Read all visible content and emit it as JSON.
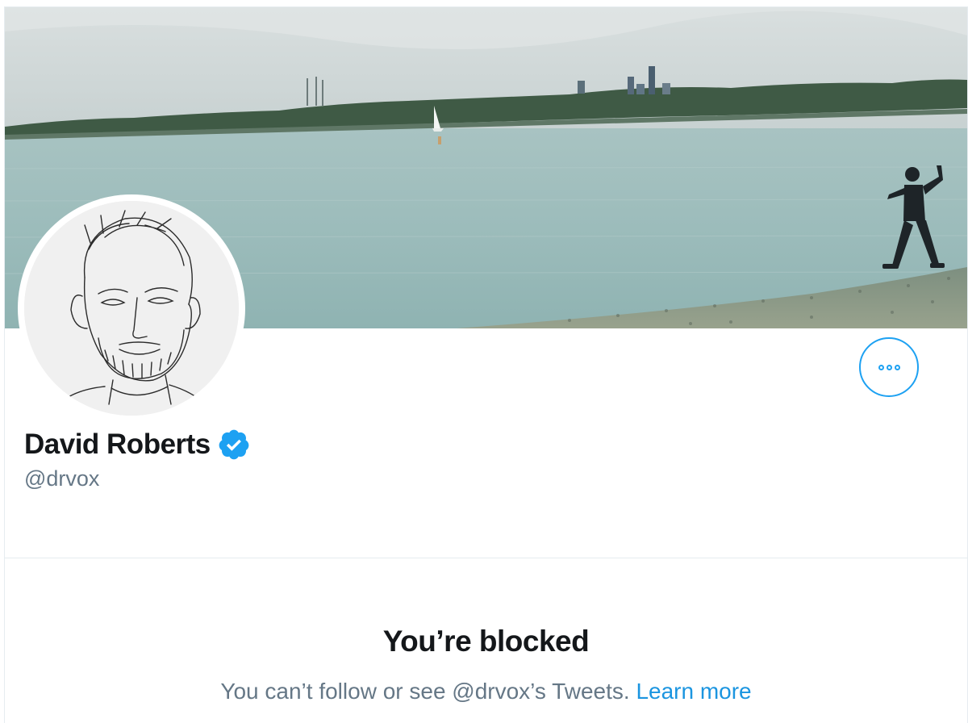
{
  "profile": {
    "display_name": "David Roberts",
    "handle": "@drvox",
    "verified_icon": "verified-badge-icon",
    "more_icon": "more-options-icon"
  },
  "blocked": {
    "title": "You’re blocked",
    "message": "You can’t follow or see @drvox’s Tweets.",
    "link_label": "Learn more"
  },
  "colors": {
    "accent": "#1da1f2",
    "link": "#1b95e0",
    "text_primary": "#14171a",
    "text_secondary": "#657786",
    "border": "#e6ecf0"
  }
}
